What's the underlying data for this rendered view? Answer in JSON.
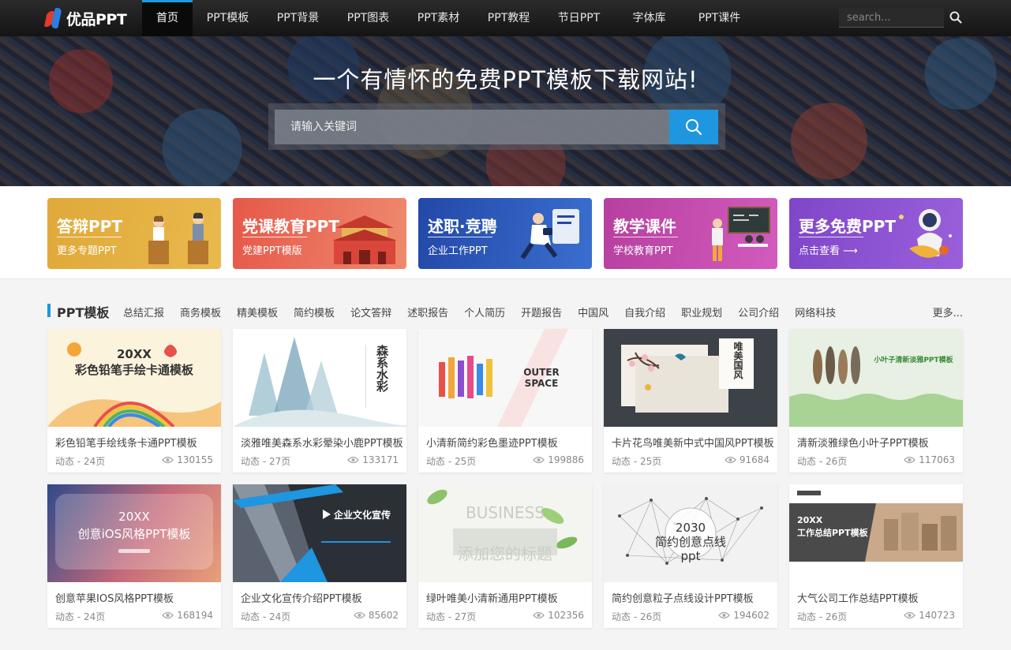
{
  "header": {
    "logo_text": "优品PPT",
    "nav": [
      "首页",
      "PPT模板",
      "PPT背景",
      "PPT图表",
      "PPT素材",
      "PPT教程",
      "节日PPT",
      "字体库",
      "PPT课件"
    ],
    "search_placeholder": "search..."
  },
  "hero": {
    "title": "一个有情怀的免费PPT模板下载网站!",
    "search_placeholder": "请输入关键词"
  },
  "categories": [
    {
      "title": "答辩PPT",
      "sub": "更多专题PPT",
      "color": "#e0a93a"
    },
    {
      "title": "党课教育PPT",
      "sub": "党建PPT模版",
      "color": "#e46a55"
    },
    {
      "title": "述职·竞聘",
      "sub": "企业工作PPT",
      "color": "#2e56b3"
    },
    {
      "title": "教学课件",
      "sub": "学校教育PPT",
      "color": "#c949a6"
    },
    {
      "title": "更多免费PPT",
      "sub": "点击查看 ⟶",
      "color": "#8a4fce"
    }
  ],
  "section": {
    "title": "PPT模板",
    "tags": [
      "总结汇报",
      "商务模板",
      "精美模板",
      "简约模板",
      "论文答辩",
      "述职报告",
      "个人简历",
      "开题报告",
      "中国风",
      "自我介绍",
      "职业规划",
      "公司介绍",
      "网络科技"
    ],
    "more": "更多..."
  },
  "cards": [
    {
      "title": "彩色铅笔手绘线条卡通PPT模板",
      "meta": "动态 - 24页",
      "views": "130155",
      "thumb_text": "20XX\n彩色铅笔手绘卡通模板"
    },
    {
      "title": "淡雅唯美森系水彩晕染小鹿PPT模板",
      "meta": "动态 - 27页",
      "views": "133171",
      "thumb_text": "森系水彩"
    },
    {
      "title": "小清新简约彩色墨迹PPT模板",
      "meta": "动态 - 25页",
      "views": "199886",
      "thumb_text": "OUTER\nSPACE"
    },
    {
      "title": "卡片花鸟唯美新中式中国风PPT模板",
      "meta": "动态 - 25页",
      "views": "91684",
      "thumb_text": "唯美国风"
    },
    {
      "title": "清新淡雅绿色小叶子PPT模板",
      "meta": "动态 - 26页",
      "views": "117063",
      "thumb_text": "小叶子清新淡雅PPT模板"
    },
    {
      "title": "创意苹果IOS风格PPT模板",
      "meta": "动态 - 24页",
      "views": "168194",
      "thumb_text": "20XX\n创意iOS风格PPT模板"
    },
    {
      "title": "企业文化宣传介绍PPT模板",
      "meta": "动态 - 24页",
      "views": "85602",
      "thumb_text": "企业文化宣传"
    },
    {
      "title": "绿叶唯美小清新通用PPT模板",
      "meta": "动态 - 27页",
      "views": "102356",
      "thumb_text": "BUSINESS\n添加您的标题"
    },
    {
      "title": "简约创意粒子点线设计PPT模板",
      "meta": "动态 - 26页",
      "views": "194602",
      "thumb_text": "2030\n简约创意点线ppt"
    },
    {
      "title": "大气公司工作总结PPT模板",
      "meta": "动态 - 26页",
      "views": "140723",
      "thumb_text": "20XX\n工作总结PPT模板"
    }
  ]
}
